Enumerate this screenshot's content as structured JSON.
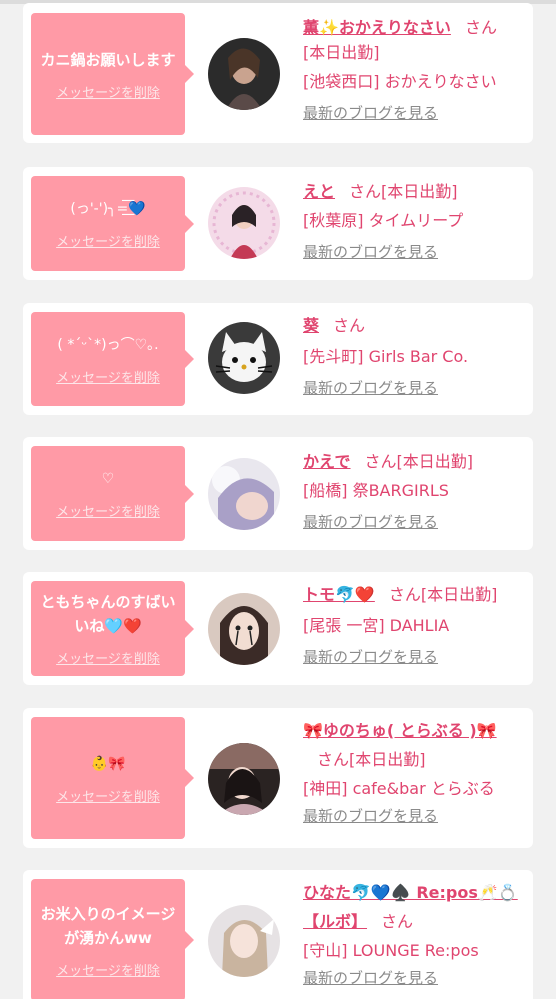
{
  "messages": [
    {
      "message": "カニ鍋お願いします",
      "delete_label": "メッセージを削除",
      "name": "薫✨おかえりなさい",
      "honorific": "さん",
      "status": "[本日出勤]",
      "location": "[池袋西口] おかえりなさい",
      "blog_label": "最新のブログを見る"
    },
    {
      "message": "(っ'-')╮=͟͟͞͞💙",
      "delete_label": "メッセージを削除",
      "name": "えと",
      "honorific": "さん",
      "status": "[本日出勤]",
      "location": "[秋葉原] タイムリープ",
      "blog_label": "最新のブログを見る"
    },
    {
      "message": "( *´ᵕ`*)っ⌒♡｡.",
      "delete_label": "メッセージを削除",
      "name": "葵",
      "honorific": "さん",
      "status": "",
      "location": "[先斗町] Girls Bar Co.",
      "blog_label": "最新のブログを見る"
    },
    {
      "message": "♡",
      "delete_label": "メッセージを削除",
      "name": "かえで",
      "honorific": "さん",
      "status": "[本日出勤]",
      "location": "[船橋] 祭BARGIRLS",
      "blog_label": "最新のブログを見る"
    },
    {
      "message": "ともちゃんのすばいいね🩵❤️",
      "delete_label": "メッセージを削除",
      "name": "トモ🐬❤️",
      "honorific": "さん",
      "status": "[本日出勤]",
      "location": "[尾張 一宮] DAHLIA",
      "blog_label": "最新のブログを見る"
    },
    {
      "message": "👶🎀",
      "delete_label": "メッセージを削除",
      "name": "🎀ゆのちゅ( とらぶる )🎀",
      "honorific": "さん",
      "status": "[本日出勤]",
      "location": "[神田] cafe&bar とらぶる",
      "blog_label": "最新のブログを見る"
    },
    {
      "message": "お米入りのイメージが湧かんww",
      "delete_label": "メッセージを削除",
      "name": "ひなた🐬💙♠️ Re:pos🥂💍【ルボ】",
      "honorific": "さん",
      "status": "",
      "location": "[守山] LOUNGE Re:pos",
      "blog_label": "最新のブログを見る"
    }
  ],
  "colors": {
    "bubble": "#ff9aa6",
    "accent_text": "#e0456f",
    "muted_link": "#8a8a8a",
    "page_bg": "#f1f1f1"
  }
}
